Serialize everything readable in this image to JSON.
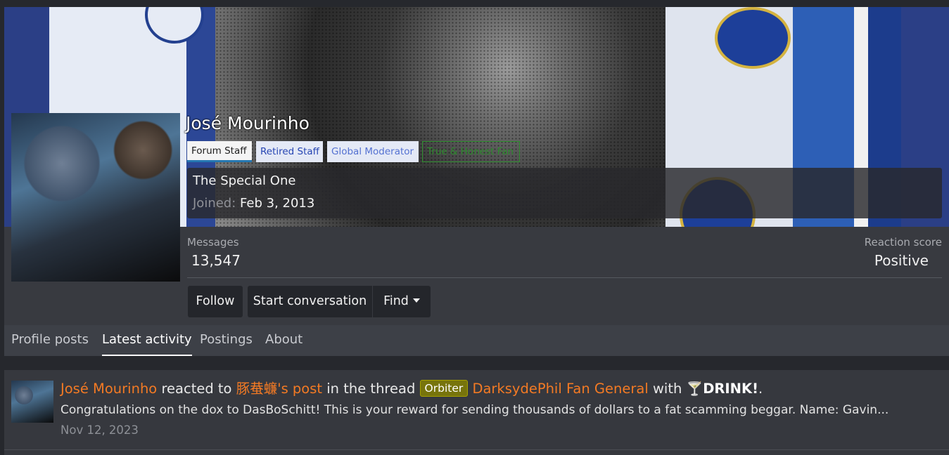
{
  "profile": {
    "username": "José Mourinho",
    "banners": [
      {
        "label": "Forum Staff"
      },
      {
        "label": "Retired Staff"
      },
      {
        "label": "Global Moderator"
      },
      {
        "label": "True & Honest Fan"
      }
    ],
    "user_title": "The Special One",
    "joined_label": "Joined:",
    "joined_date": "Feb 3, 2013",
    "stats": {
      "messages_label": "Messages",
      "messages_value": "13,547",
      "reaction_label": "Reaction score",
      "reaction_value": "Positive"
    },
    "buttons": {
      "follow": "Follow",
      "start_conversation": "Start conversation",
      "find": "Find"
    }
  },
  "tabs": [
    {
      "label": "Profile posts",
      "active": false
    },
    {
      "label": "Latest activity",
      "active": true
    },
    {
      "label": "Postings",
      "active": false
    },
    {
      "label": "About",
      "active": false
    }
  ],
  "activity": {
    "user": "José Mourinho",
    "reacted_to": "reacted to",
    "post_owner": "豚蛬蠊's post",
    "in_the_thread": "in the thread",
    "prefix": "Orbiter",
    "thread_title": "DarksydePhil Fan General",
    "with": "with",
    "reaction_emoji": "🍸",
    "reaction_name": "DRINK!",
    "period": ".",
    "snippet": "Congratulations on the dox to DasBoSchitt! This is your reward for sending thousands of dollars to a fat scamming beggar. Name: Gavin...",
    "date": "Nov 12, 2023"
  },
  "colors": {
    "page_bg": "#26282d",
    "link_orange": "#f37a24",
    "prefix_badge": "#77740c",
    "staff_badge_accent": "#2577b1"
  },
  "icons": {
    "find_caret": "chevron-down-icon",
    "reaction": "cocktail-icon"
  }
}
